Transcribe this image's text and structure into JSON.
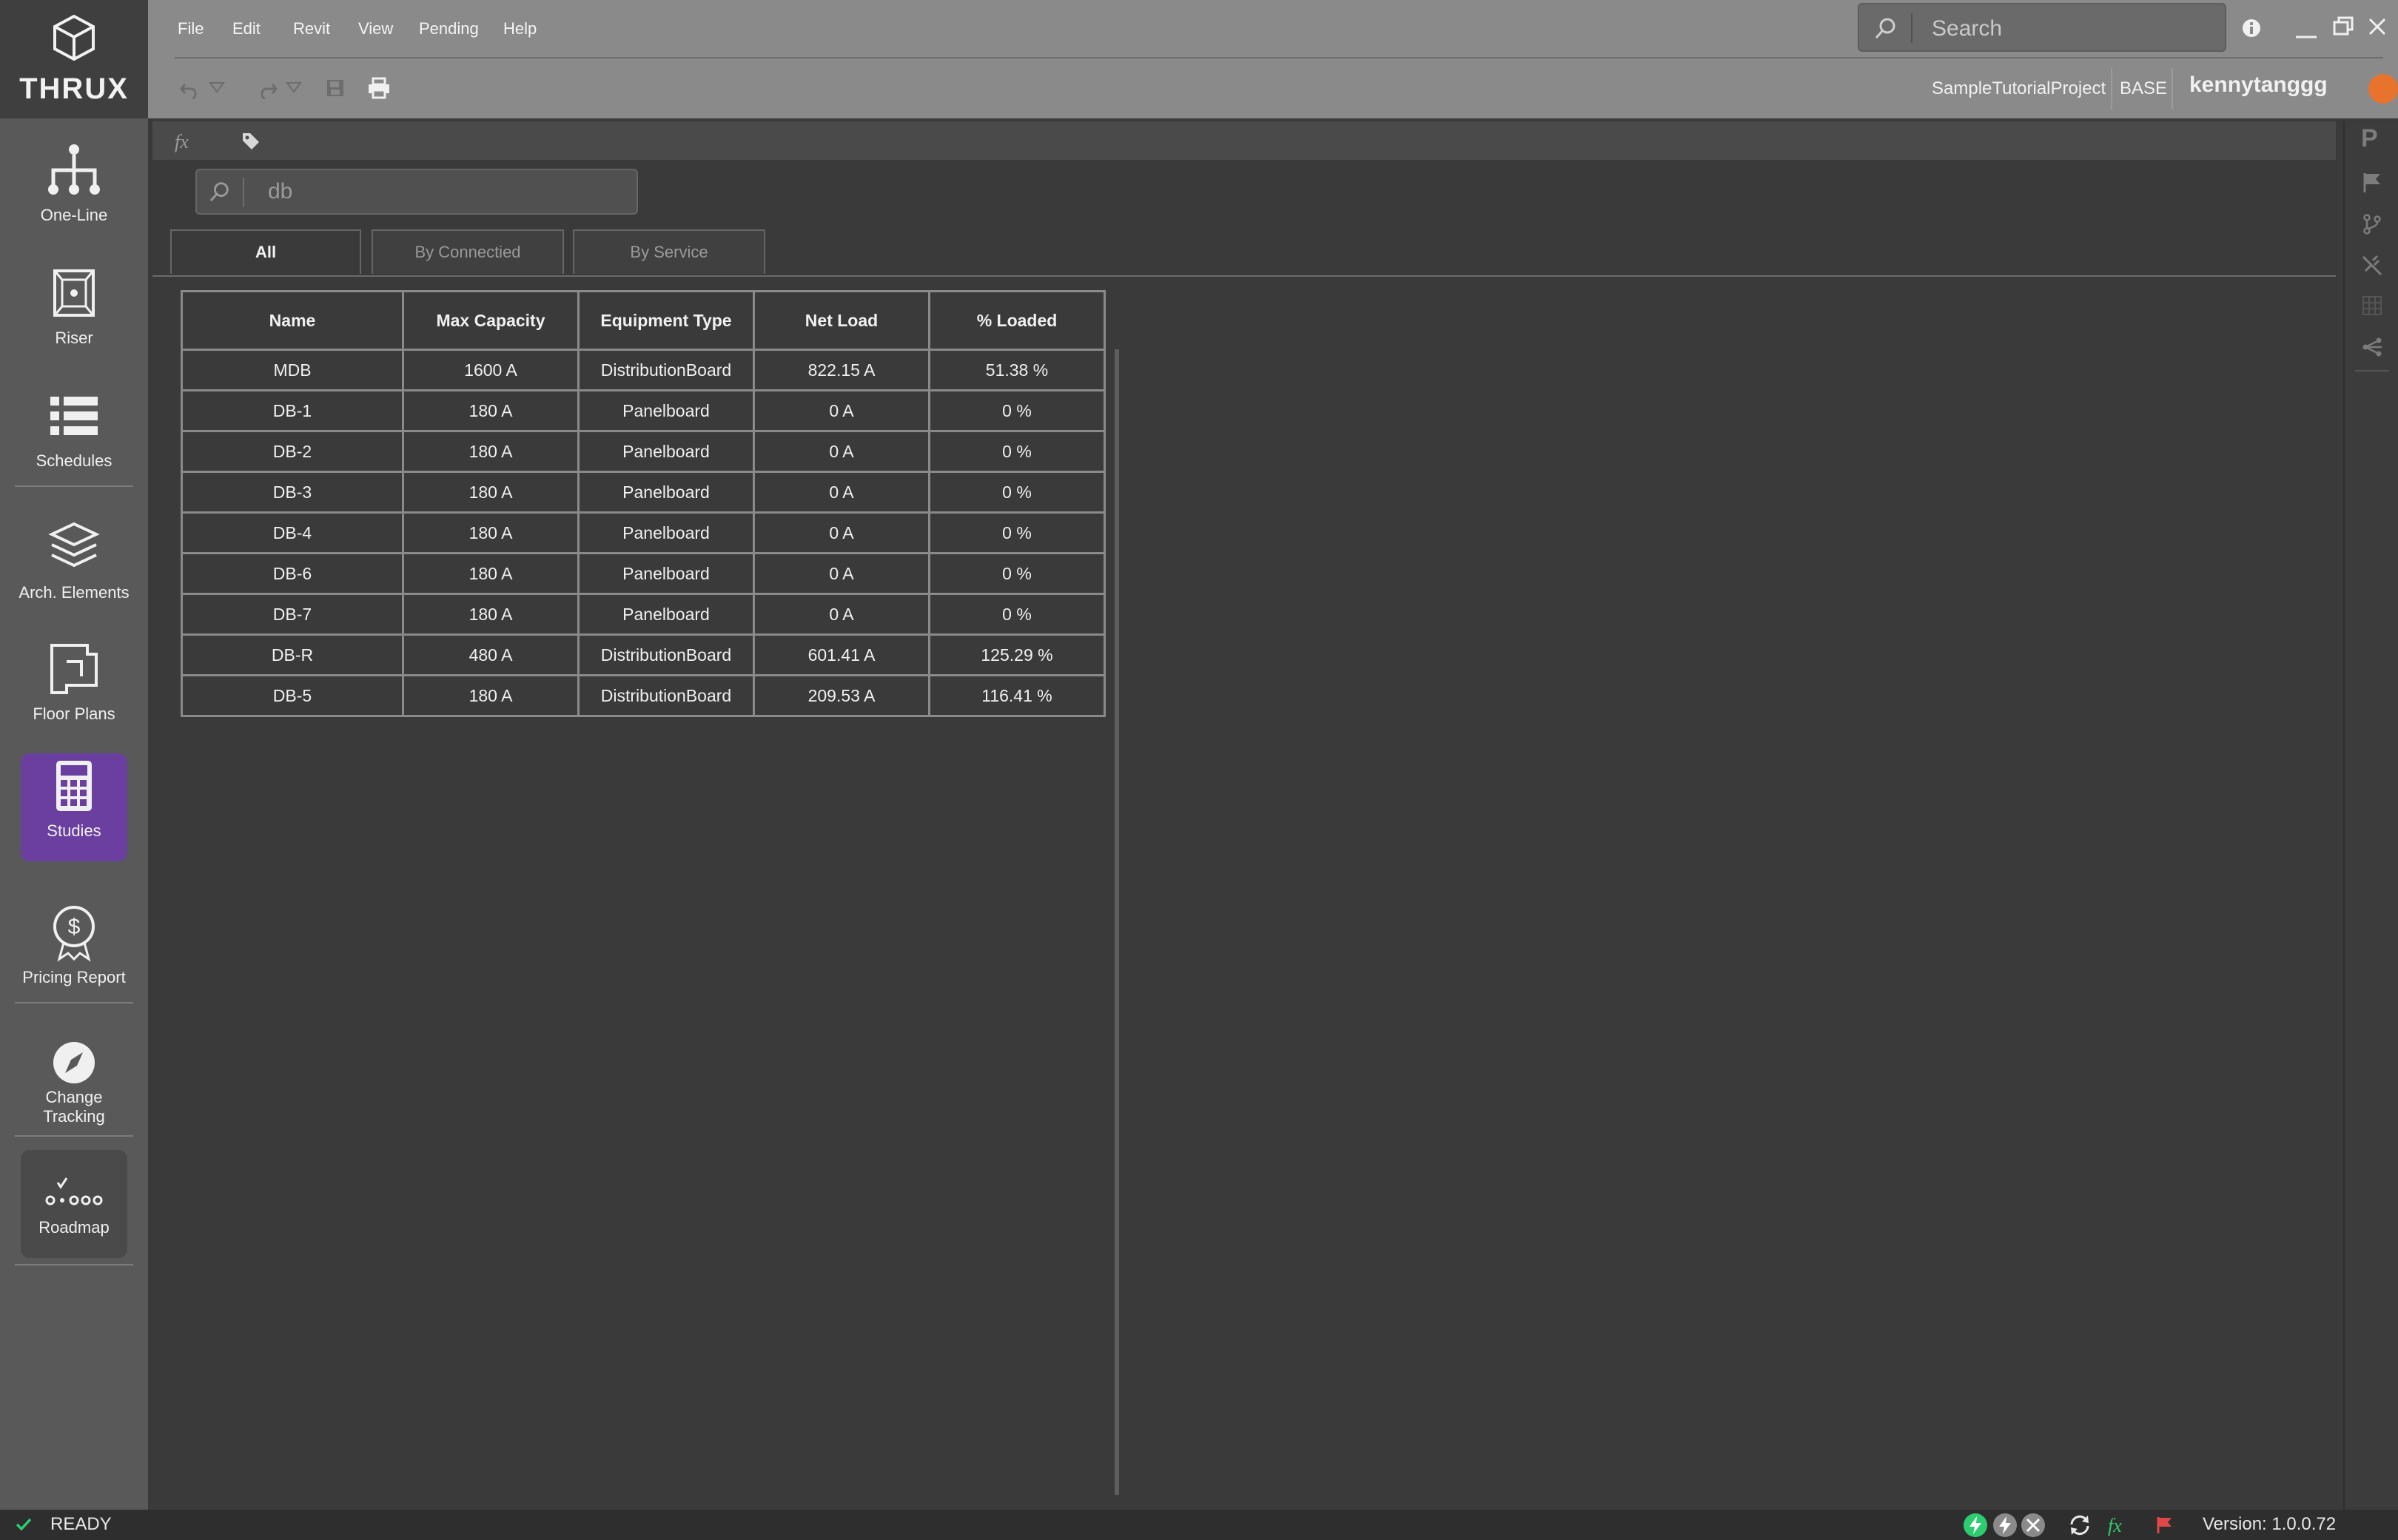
{
  "app": {
    "logo_text": "THRUX"
  },
  "sidebar": {
    "items": [
      {
        "label": "One-Line",
        "icon": "hierarchy-icon"
      },
      {
        "label": "Riser",
        "icon": "cube-icon"
      },
      {
        "label": "Schedules",
        "icon": "list-icon"
      },
      {
        "label": "Arch. Elements",
        "icon": "layers-icon"
      },
      {
        "label": "Floor Plans",
        "icon": "floor-plan-icon"
      },
      {
        "label": "Studies",
        "icon": "calculator-icon",
        "active": true
      },
      {
        "label": "Pricing Report",
        "icon": "dollar-badge-icon"
      },
      {
        "label": "Change",
        "label2": "Tracking",
        "icon": "compass-icon"
      },
      {
        "label": "Roadmap",
        "icon": "roadmap-icon"
      }
    ]
  },
  "menubar": {
    "items": [
      "File",
      "Edit",
      "Revit",
      "View",
      "Pending",
      "Help"
    ]
  },
  "search": {
    "placeholder": "Search"
  },
  "project": {
    "name": "SampleTutorialProject",
    "branch": "BASE",
    "user": "kennytanggg"
  },
  "filter": {
    "value": "db"
  },
  "tabs": [
    "All",
    "By Connectied",
    "By Service"
  ],
  "table": {
    "columns": [
      "Name",
      "Max Capacity",
      "Equipment Type",
      "Net Load",
      "% Loaded"
    ],
    "rows": [
      [
        "MDB",
        "1600 A",
        "DistributionBoard",
        "822.15 A",
        "51.38 %"
      ],
      [
        "DB-1",
        "180 A",
        "Panelboard",
        "0 A",
        "0 %"
      ],
      [
        "DB-2",
        "180 A",
        "Panelboard",
        "0 A",
        "0 %"
      ],
      [
        "DB-3",
        "180 A",
        "Panelboard",
        "0 A",
        "0 %"
      ],
      [
        "DB-4",
        "180 A",
        "Panelboard",
        "0 A",
        "0 %"
      ],
      [
        "DB-6",
        "180 A",
        "Panelboard",
        "0 A",
        "0 %"
      ],
      [
        "DB-7",
        "180 A",
        "Panelboard",
        "0 A",
        "0 %"
      ],
      [
        "DB-R",
        "480 A",
        "DistributionBoard",
        "601.41 A",
        "125.29 %"
      ],
      [
        "DB-5",
        "180 A",
        "DistributionBoard",
        "209.53 A",
        "116.41 %"
      ]
    ]
  },
  "right_rail": {
    "top_letter": "P"
  },
  "statusbar": {
    "status": "READY",
    "version": "Version: 1.0.0.72"
  },
  "colors": {
    "accent": "#6b3fa0",
    "status_green": "#2ecc71",
    "user_orange": "#e8732c"
  }
}
